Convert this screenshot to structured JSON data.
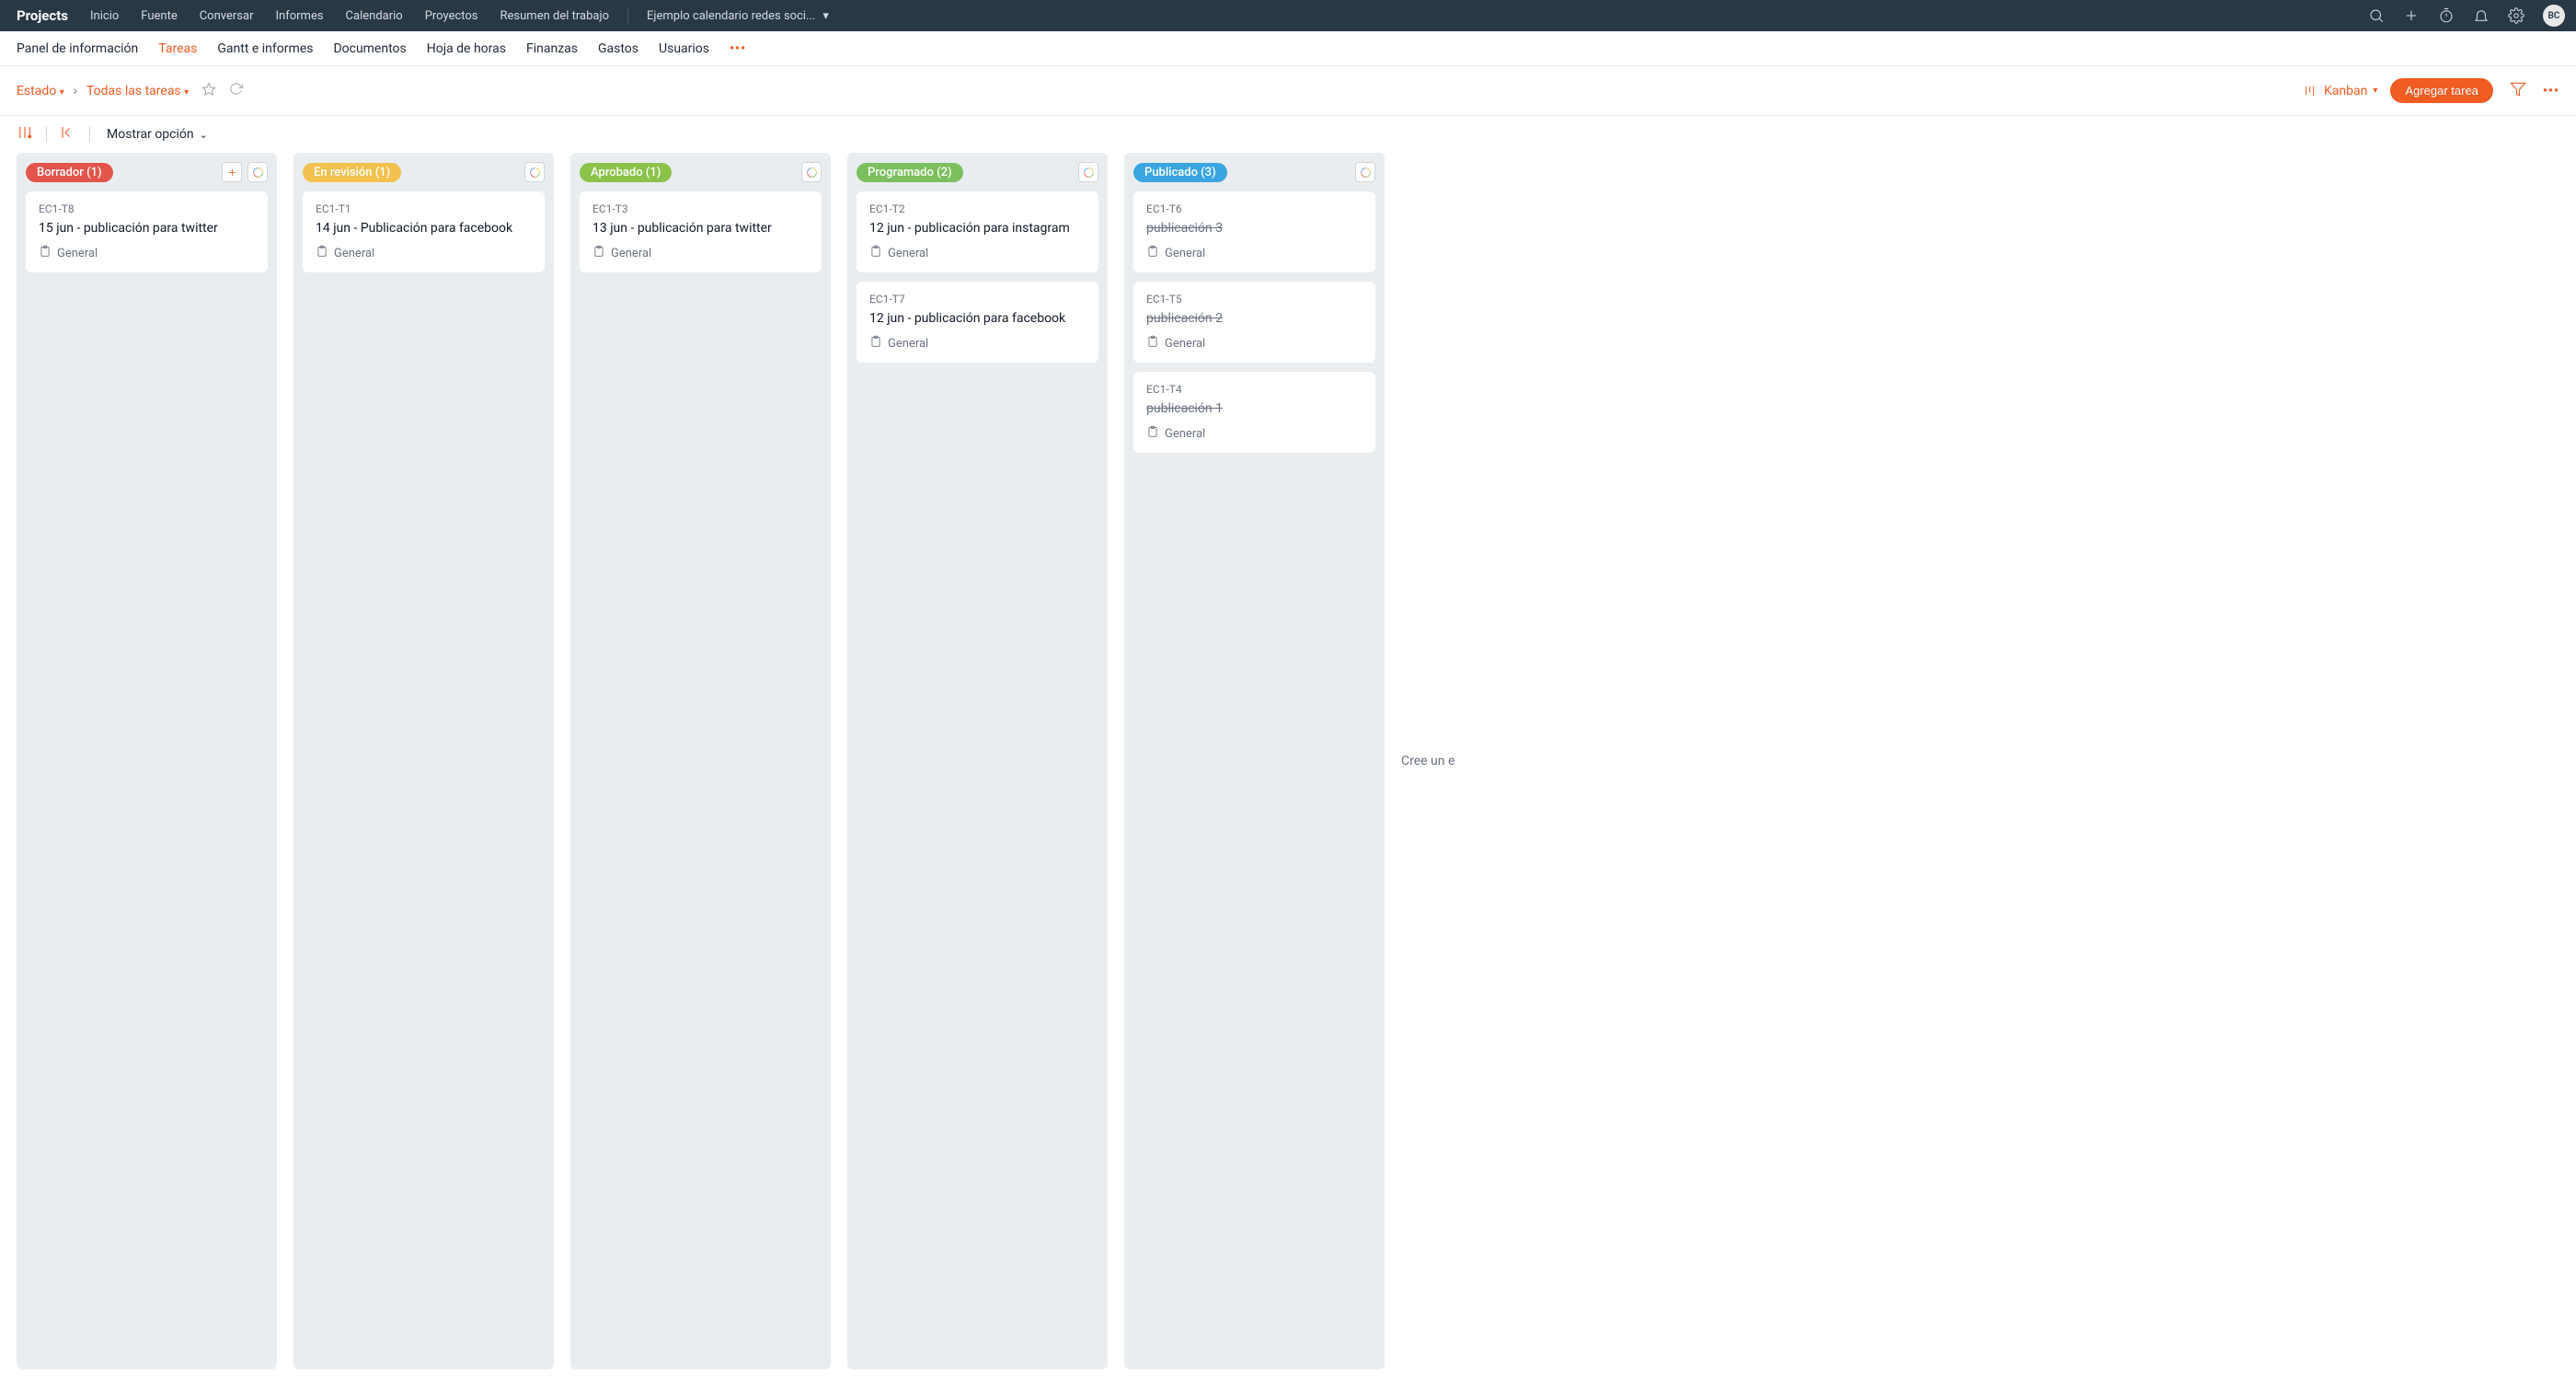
{
  "topbar": {
    "brand": "Projects",
    "nav": [
      "Inicio",
      "Fuente",
      "Conversar",
      "Informes",
      "Calendario",
      "Proyectos",
      "Resumen del trabajo"
    ],
    "project_name": "Ejemplo calendario redes soci...",
    "avatar": "BC"
  },
  "subtabs": {
    "items": [
      "Panel de información",
      "Tareas",
      "Gantt e informes",
      "Documentos",
      "Hoja de horas",
      "Finanzas",
      "Gastos",
      "Usuarios"
    ],
    "active_index": 1
  },
  "toolbar": {
    "crumb1": "Estado",
    "crumb2": "Todas las tareas",
    "view_label": "Kanban",
    "add_label": "Agregar tarea"
  },
  "optbar": {
    "show_label": "Mostrar opción"
  },
  "columns": [
    {
      "label": "Borrador (1)",
      "color": "#e3544b",
      "show_plus": true,
      "cards": [
        {
          "code": "EC1-T8",
          "title": "15 jun - publicación para twitter",
          "tag": "General",
          "done": false
        }
      ]
    },
    {
      "label": "En revisión (1)",
      "color": "#f2c14e",
      "show_plus": false,
      "cards": [
        {
          "code": "EC1-T1",
          "title": "14 jun - Publicación para facebook",
          "tag": "General",
          "done": false
        }
      ]
    },
    {
      "label": "Aprobado (1)",
      "color": "#8bc34a",
      "show_plus": false,
      "cards": [
        {
          "code": "EC1-T3",
          "title": "13 jun - publicación para twitter",
          "tag": "General",
          "done": false
        }
      ]
    },
    {
      "label": "Programado (2)",
      "color": "#7bbf5e",
      "show_plus": false,
      "cards": [
        {
          "code": "EC1-T2",
          "title": "12 jun - publicación para instagram",
          "tag": "General",
          "done": false
        },
        {
          "code": "EC1-T7",
          "title": "12 jun - publicación para facebook",
          "tag": "General",
          "done": false
        }
      ]
    },
    {
      "label": "Publicado (3)",
      "color": "#3aa5e0",
      "show_plus": false,
      "cards": [
        {
          "code": "EC1-T6",
          "title": "publicación 3",
          "tag": "General",
          "done": true
        },
        {
          "code": "EC1-T5",
          "title": "publicación 2",
          "tag": "General",
          "done": true
        },
        {
          "code": "EC1-T4",
          "title": "publicación 1",
          "tag": "General",
          "done": true
        }
      ]
    }
  ],
  "extra_col_hint": "Cree un e"
}
